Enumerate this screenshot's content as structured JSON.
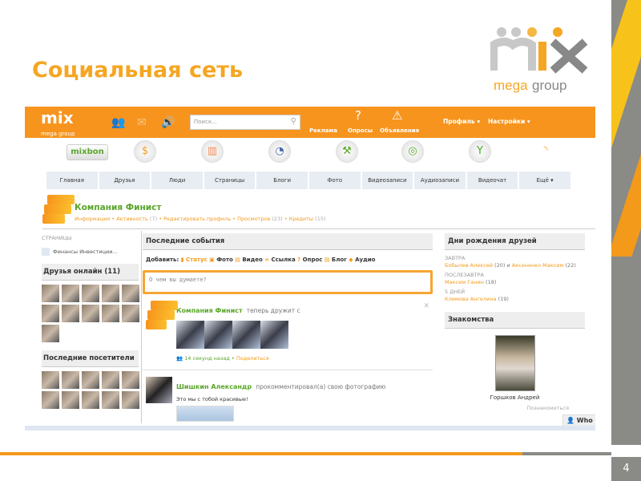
{
  "slide": {
    "title": "Социальная сеть",
    "page_number": "4",
    "logo_text": "mix mega group"
  },
  "app": {
    "logo": "mix",
    "logo_sub": "mega group",
    "search_placeholder": "Поиск...",
    "top_links": [
      "Реклама",
      "Опросы",
      "Объявления"
    ],
    "menus": [
      "Профиль ▾",
      "Настройки ▾"
    ],
    "mixbon": "mixbon",
    "nav": [
      "Главная",
      "Друзья",
      "Люди",
      "Страницы",
      "Блоги",
      "Фото",
      "Видеозаписи",
      "Аудиозаписи",
      "Видеочат",
      "Ещё ▾"
    ],
    "profile": {
      "name": "Компания Финист",
      "links": [
        {
          "label": "Информация",
          "count": ""
        },
        {
          "label": "Активность",
          "count": "(7)"
        },
        {
          "label": "Редактировать профиль",
          "count": ""
        },
        {
          "label": "Просмотров",
          "count": "(23)"
        },
        {
          "label": "Кредиты",
          "count": "(15)"
        }
      ]
    },
    "left": {
      "pages_header": "СТРАНИЦЫ",
      "pages_item": "Финансы Инвестиции...",
      "friends_online": "Друзья онлайн (11)",
      "last_visitors": "Последние посетители"
    },
    "feed": {
      "header": "Последние события",
      "add_label": "Добавить:",
      "add_items": [
        "Статус",
        "Фото",
        "Видео",
        "Ссылка",
        "Опрос",
        "Блог",
        "Аудио"
      ],
      "status_placeholder": "О чем вы думаете?",
      "events": [
        {
          "who": "Компания Финист",
          "action": "теперь дружит с",
          "time": "14 секунд назад",
          "share": "Поделиться"
        },
        {
          "who": "Шишкин Александр",
          "action": "прокомментировал(а) свою фотографию",
          "comment": "Это мы с тобой красивые!"
        }
      ]
    },
    "right": {
      "birthdays_header": "Дни рождения друзей",
      "b_tomorrow": "ЗАВТРА",
      "b1": "Бобылев Алексей",
      "b1age": "(20)",
      "and": "и",
      "b2": "Аксененко Максим",
      "b2age": "(22)",
      "b_after": "ПОСЛЕЗАВТРА",
      "b3": "Максим Ганин",
      "b3age": "(18)",
      "b_5days": "5 ДНЕЙ",
      "b4": "Климова Ангелина",
      "b4age": "(19)",
      "dating_header": "Знакомства",
      "dating_name": "Горшков Андрей",
      "dating_link": "Познакомиться"
    },
    "who_button": "Who"
  }
}
